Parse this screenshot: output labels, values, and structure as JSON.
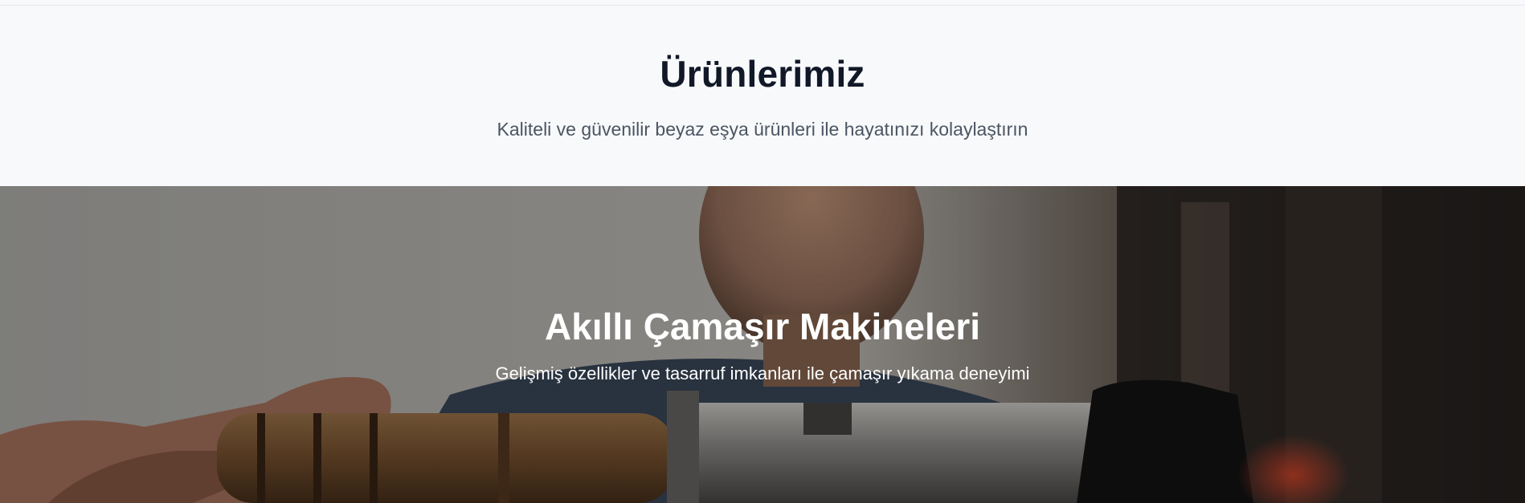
{
  "products_section": {
    "title": "Ürünlerimiz",
    "subtitle": "Kaliteli ve güvenilir beyaz eşya ürünleri ile hayatınızı kolaylaştırın"
  },
  "hero_banner": {
    "title": "Akıllı Çamaşır Makineleri",
    "subtitle": "Gelişmiş özellikler ve tasarruf imkanları ile çamaşır yıkama deneyimi",
    "background_image": "person-holding-tool-photo"
  },
  "colors": {
    "page_background": "#f8f9fb",
    "heading": "#111827",
    "subheading": "#4b5563",
    "hero_text": "#ffffff"
  }
}
